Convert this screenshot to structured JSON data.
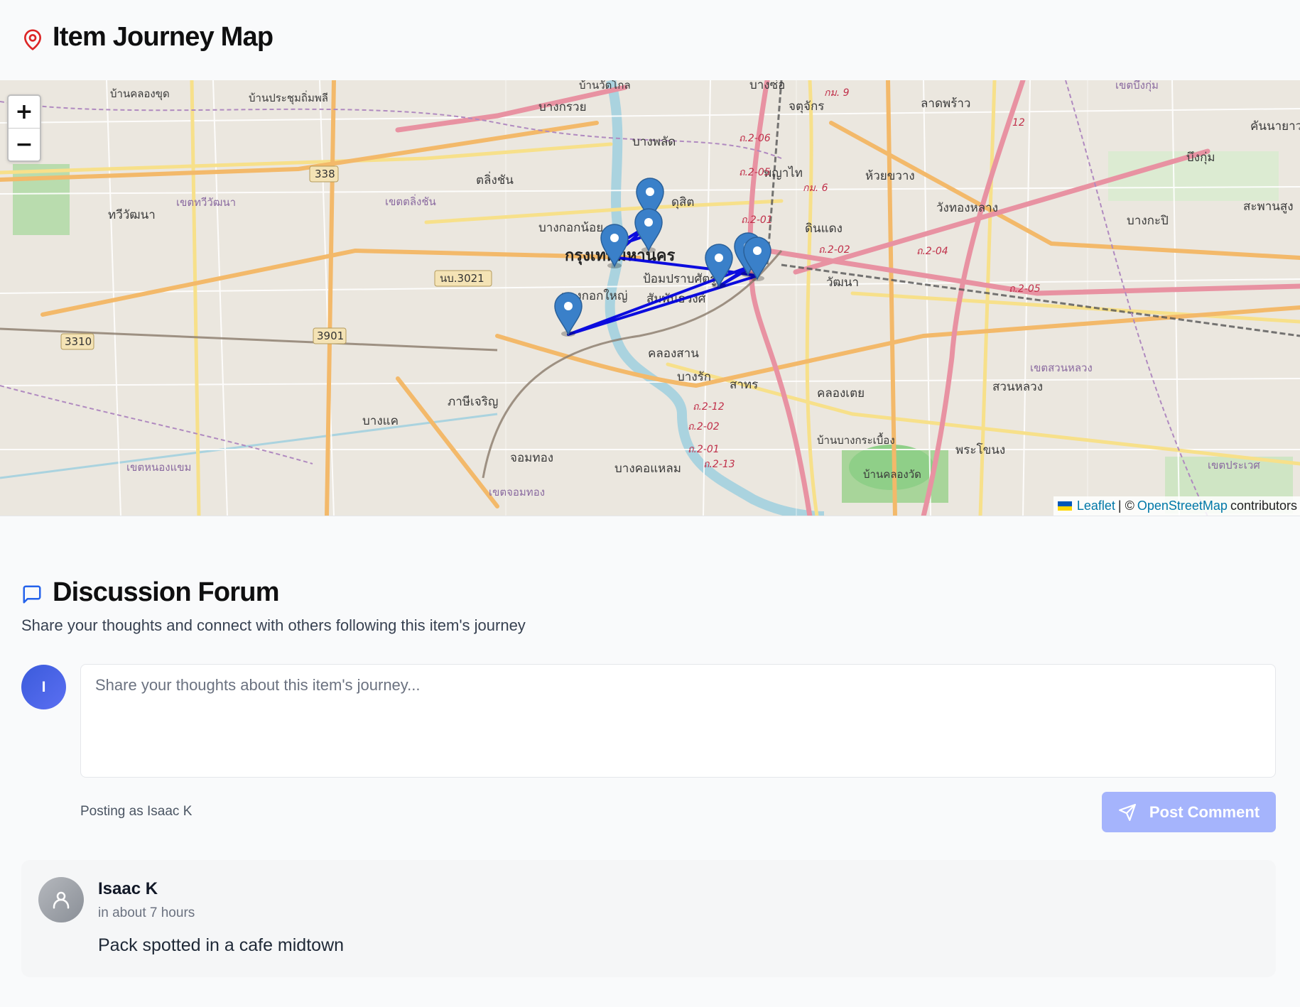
{
  "header": {
    "title": "Item Journey Map",
    "icon": "map-pin-icon",
    "icon_color": "#dc2626"
  },
  "map": {
    "zoom_in_label": "+",
    "zoom_out_label": "−",
    "attribution": {
      "leaflet": "Leaflet",
      "separator": "| ©",
      "osm": "OpenStreetMap",
      "suffix": "contributors"
    },
    "route_color": "#0000dd",
    "marker_color": "#3a80c9",
    "place_labels": [
      "บ้านคลองขุด",
      "บ้านประชุมถิ่มพลี",
      "บ้านวัดโกล",
      "บางกรวย",
      "บางซ่อ",
      "จตุจักร",
      "ลาดพร้าว",
      "เขตบึงกุ่ม",
      "คันนายาว",
      "บางพลัด",
      "บึงกุ่ม",
      "ตลิ่งชัน",
      "ดุสิต",
      "พญาไท",
      "ห้วยขวาง",
      "เขตทวีวัฒนา",
      "เขตตลิ่งชัน",
      "ทวีวัฒนา",
      "บางกอกน้อย",
      "กรุงเทพมหานคร",
      "ดินแดง",
      "วังทองหลาง",
      "บางกะปิ",
      "สะพานสูง",
      "ป้อมปราบศัตรูพ่าย",
      "สัมพันธวงศ์",
      "บางกอกใหญ่",
      "วัฒนา",
      "คลองสาน",
      "บางรัก",
      "สาทร",
      "เขตสวนหลวง",
      "ภาษีเจริญ",
      "บางแค",
      "คลองเตย",
      "สวนหลวง",
      "พระโขนง",
      "จอมทอง",
      "บางคอแหลม",
      "เขตหนองแขม",
      "เขตจอมทอง",
      "บ้านบางกระเบื้อง",
      "บ้านคลองวัด",
      "เขตประเวศ"
    ],
    "road_labels": [
      "338",
      "3901",
      "3310",
      "นบ.3021"
    ]
  },
  "forum": {
    "title": "Discussion Forum",
    "icon": "chat-bubble-icon",
    "subtitle": "Share your thoughts and connect with others following this item's journey",
    "avatar_initial": "I",
    "input_placeholder": "Share your thoughts about this item's journey...",
    "posting_as": "Posting as Isaac K",
    "post_button_label": "Post Comment",
    "comments": [
      {
        "author": "Isaac K",
        "time": "in about 7 hours",
        "body": "Pack spotted in a cafe midtown"
      }
    ]
  }
}
